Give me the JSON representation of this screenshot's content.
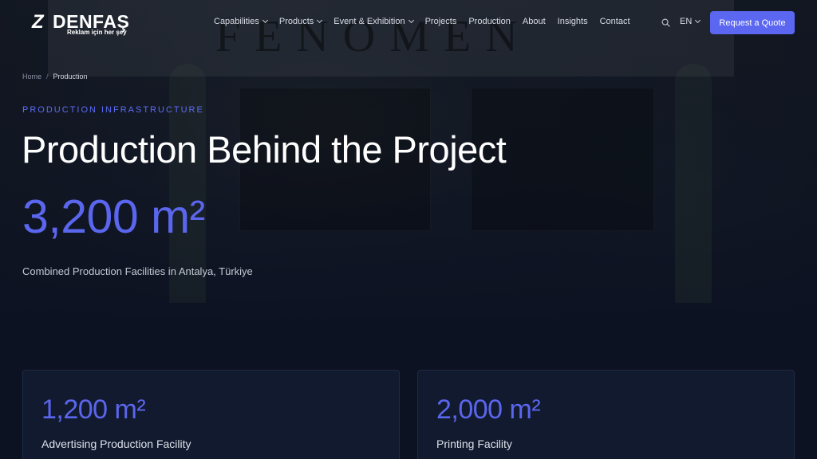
{
  "brand": {
    "name": "DENFAŞ",
    "tagline": "Reklam için her şey"
  },
  "nav": {
    "items": [
      {
        "label": "Capabilities",
        "has_dropdown": true
      },
      {
        "label": "Products",
        "has_dropdown": true
      },
      {
        "label": "Event & Exhibition",
        "has_dropdown": true
      },
      {
        "label": "Projects",
        "has_dropdown": false
      },
      {
        "label": "Production",
        "has_dropdown": false
      },
      {
        "label": "About",
        "has_dropdown": false
      },
      {
        "label": "Insights",
        "has_dropdown": false
      },
      {
        "label": "Contact",
        "has_dropdown": false
      }
    ],
    "language": "EN",
    "cta_label": "Request a Quote"
  },
  "breadcrumb": {
    "home": "Home",
    "separator": "/",
    "current": "Production"
  },
  "hero": {
    "eyebrow": "PRODUCTION INFRASTRUCTURE",
    "title": "Production Behind the Project",
    "stat": "3,200 m²",
    "subtitle": "Combined Production Facilities in Antalya, Türkiye",
    "background_sign": "FENOMEN"
  },
  "facilities": [
    {
      "value": "1,200 m²",
      "label": "Advertising Production Facility"
    },
    {
      "value": "2,000 m²",
      "label": "Printing Facility"
    }
  ],
  "colors": {
    "accent": "#5b67f1",
    "background": "#0c1222",
    "card": "#111a2e"
  },
  "icons": {
    "search": "search-icon",
    "dropdown": "chevron-down-icon"
  }
}
